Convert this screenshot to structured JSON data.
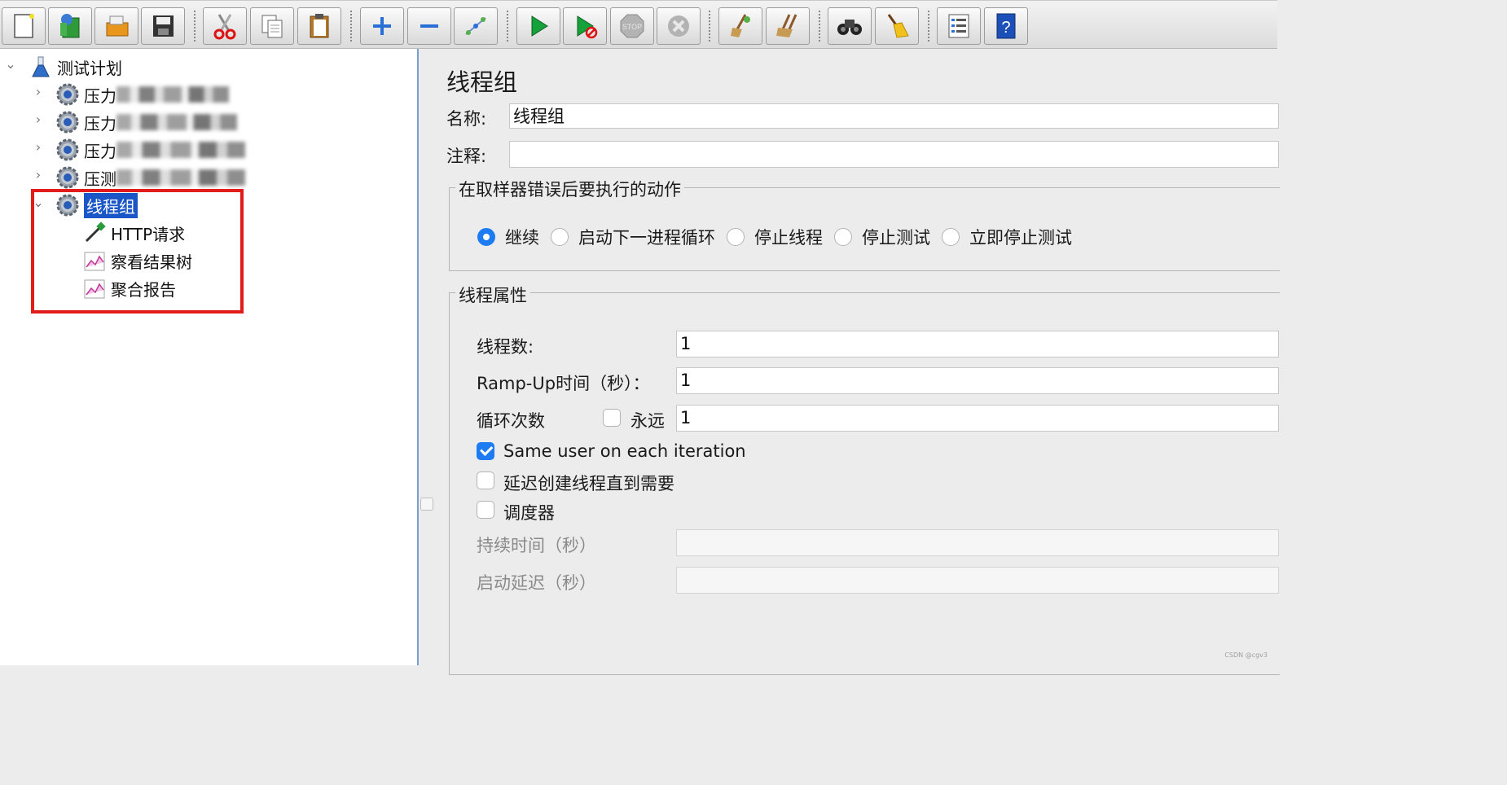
{
  "toolbar": {
    "buttons": [
      {
        "icon": "new-icon"
      },
      {
        "icon": "templates-icon"
      },
      {
        "icon": "open-icon"
      },
      {
        "icon": "save-icon"
      },
      {
        "icon": "cut-icon"
      },
      {
        "icon": "copy-icon"
      },
      {
        "icon": "paste-icon"
      },
      {
        "icon": "expand-icon"
      },
      {
        "icon": "collapse-icon"
      },
      {
        "icon": "toggle-icon"
      },
      {
        "icon": "start-icon"
      },
      {
        "icon": "start-no-pauses-icon"
      },
      {
        "icon": "stop-icon"
      },
      {
        "icon": "shutdown-icon"
      },
      {
        "icon": "clear-icon"
      },
      {
        "icon": "clear-all-icon"
      },
      {
        "icon": "search-icon"
      },
      {
        "icon": "reset-search-icon"
      },
      {
        "icon": "function-helper-icon"
      },
      {
        "icon": "help-icon"
      }
    ],
    "stop_text": "STOP"
  },
  "tree": {
    "root": "测试计划",
    "items": [
      {
        "label": "压力",
        "blurred": true
      },
      {
        "label": "压力",
        "blurred": true
      },
      {
        "label": "压力",
        "blurred": true
      },
      {
        "label": "压测",
        "blurred": true
      },
      {
        "label": "线程组",
        "selected": true
      }
    ],
    "children": [
      {
        "label": "HTTP请求"
      },
      {
        "label": "察看结果树"
      },
      {
        "label": "聚合报告"
      }
    ]
  },
  "editor": {
    "title": "线程组",
    "name_label": "名称:",
    "name_value": "线程组",
    "comment_label": "注释:",
    "comment_value": "",
    "sampler_error": {
      "legend": "在取样器错误后要执行的动作",
      "options": [
        "继续",
        "启动下一进程循环",
        "停止线程",
        "停止测试",
        "立即停止测试"
      ],
      "selected": "继续"
    },
    "thread_props": {
      "legend": "线程属性",
      "threads_label": "线程数:",
      "threads_value": "1",
      "rampup_label": "Ramp-Up时间（秒）：",
      "rampup_value": "1",
      "loop_label": "循环次数",
      "forever_label": "永远",
      "forever_checked": false,
      "loop_value": "1",
      "same_user_label": "Same user on each iteration",
      "same_user_checked": true,
      "delay_label": "延迟创建线程直到需要",
      "delay_checked": false,
      "scheduler_label": "调度器",
      "scheduler_checked": false,
      "duration_label": "持续时间（秒）",
      "duration_value": "",
      "startup_delay_label": "启动延迟（秒）",
      "startup_delay_value": ""
    }
  },
  "watermark": "CSDN @cgv3",
  "colors": {
    "highlight": "#e21b1b",
    "selection": "#1a56c8",
    "accent": "#1d7cf2"
  }
}
